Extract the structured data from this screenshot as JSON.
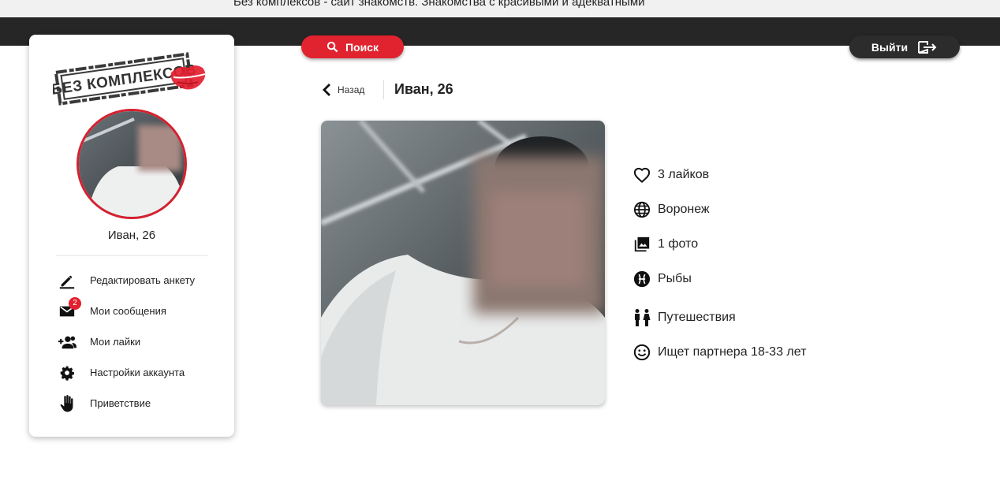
{
  "top_strip": {
    "text": "Без комплексов - сайт знакомств. Знакомства с красивыми и адекватными"
  },
  "logo": {
    "text": "БЕЗ КОМПЛЕКСОВ"
  },
  "sidebar": {
    "user_name": "Иван, 26",
    "menu": [
      {
        "label": "Редактировать анкету",
        "icon": "pencil-icon"
      },
      {
        "label": "Мои сообщения",
        "icon": "envelope-icon",
        "badge": "2"
      },
      {
        "label": "Мои лайки",
        "icon": "add-person-icon"
      },
      {
        "label": "Настройки аккаунта",
        "icon": "gear-icon"
      },
      {
        "label": "Приветствие",
        "icon": "hand-icon"
      }
    ]
  },
  "header": {
    "search_label": "Поиск",
    "logout_label": "Выйти"
  },
  "profile": {
    "back_label": "Назад",
    "title": "Иван, 26",
    "info": [
      {
        "icon": "heart-icon",
        "text": "3 лайков"
      },
      {
        "icon": "globe-icon",
        "text": "Воронеж"
      },
      {
        "icon": "photos-icon",
        "text": "1 фото"
      },
      {
        "icon": "pisces-icon",
        "text": "Рыбы"
      },
      {
        "icon": "travel-people-icon",
        "text": "Путешествия"
      },
      {
        "icon": "smiley-icon",
        "text": "Ищет партнера 18-33 лет"
      }
    ]
  },
  "colors": {
    "accent": "#e1232f",
    "dark_bar": "#262626",
    "text": "#222222"
  }
}
